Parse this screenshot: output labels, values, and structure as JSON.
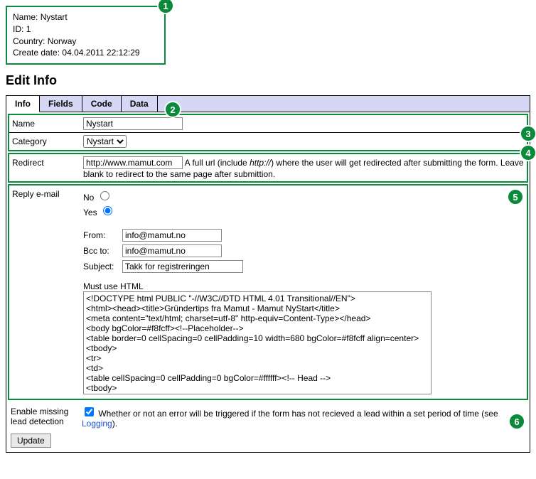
{
  "infoBox": {
    "nameLabel": "Name:",
    "nameValue": "Nystart",
    "idLabel": "ID:",
    "idValue": "1",
    "countryLabel": "Country:",
    "countryValue": "Norway",
    "createLabel": "Create date:",
    "createValue": "04.04.2011 22:12:29"
  },
  "pageTitle": "Edit Info",
  "tabs": {
    "info": "Info",
    "fields": "Fields",
    "code": "Code",
    "data": "Data"
  },
  "form": {
    "nameLabel": "Name",
    "nameValue": "Nystart",
    "categoryLabel": "Category",
    "categoryValue": "Nystart",
    "redirectLabel": "Redirect",
    "redirectValue": "http://www.mamut.com",
    "redirectHintA": "A full url (include ",
    "redirectHintB": "http://",
    "redirectHintC": ") where the user will get redirected after submitting the form. Leave blank to redirect to the same page after submittion.",
    "replyLabel": "Reply e-mail",
    "no": "No",
    "yes": "Yes",
    "fromLabel": "From:",
    "fromValue": "info@mamut.no",
    "bccLabel": "Bcc to:",
    "bccValue": "info@mamut.no",
    "subjectLabel": "Subject:",
    "subjectValue": "Takk for registreringen",
    "mustUseHtml": "Must use HTML",
    "htmlBody": "<!DOCTYPE html PUBLIC \"-//W3C//DTD HTML 4.01 Transitional//EN\">\n<html><head><title>Gründertips fra Mamut - Mamut NyStart</title>\n<meta content=\"text/html; charset=utf-8\" http-equiv=Content-Type></head>\n<body bgColor=#f8fcff><!--Placeholder-->\n<table border=0 cellSpacing=0 cellPadding=10 width=680 bgColor=#f8fcff align=center>\n<tbody>\n<tr>\n<td>\n<table cellSpacing=0 cellPadding=0 bgColor=#ffffff><!-- Head -->\n<tbody>",
    "leadLabel1": "Enable missing",
    "leadLabel2": "lead detection",
    "leadHintA": "Whether or not an error will be triggered if the form has not recieved a lead within a set period of time (see ",
    "leadHintB": "Logging",
    "leadHintC": ").",
    "updateLabel": "Update"
  },
  "badges": {
    "b1": "1",
    "b2": "2",
    "b3": "3",
    "b4": "4",
    "b5": "5",
    "b6": "6"
  }
}
